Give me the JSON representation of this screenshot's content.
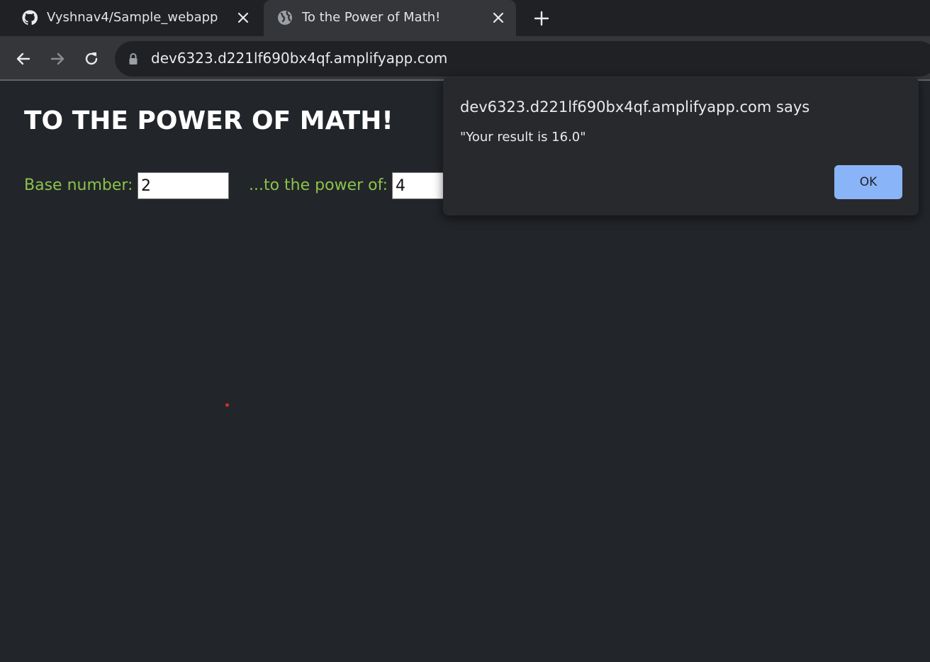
{
  "browser": {
    "tabs": [
      {
        "title": "Vyshnav4/Sample_webapp",
        "icon": "github-icon",
        "active": false
      },
      {
        "title": "To the Power of Math!",
        "icon": "globe-icon",
        "active": true
      }
    ],
    "url": "dev6323.d221lf690bx4qf.amplifyapp.com"
  },
  "page": {
    "title": "TO THE POWER OF MATH!",
    "base_label": "Base number:",
    "base_value": "2",
    "power_label": "...to the power of:",
    "power_value": "4"
  },
  "dialog": {
    "origin": "dev6323.d221lf690bx4qf.amplifyapp.com says",
    "message": "\"Your result is 16.0\"",
    "ok_label": "OK"
  },
  "colors": {
    "page_bg": "#222529",
    "label_green": "#8bc34a",
    "ok_button": "#8ab4f8"
  }
}
